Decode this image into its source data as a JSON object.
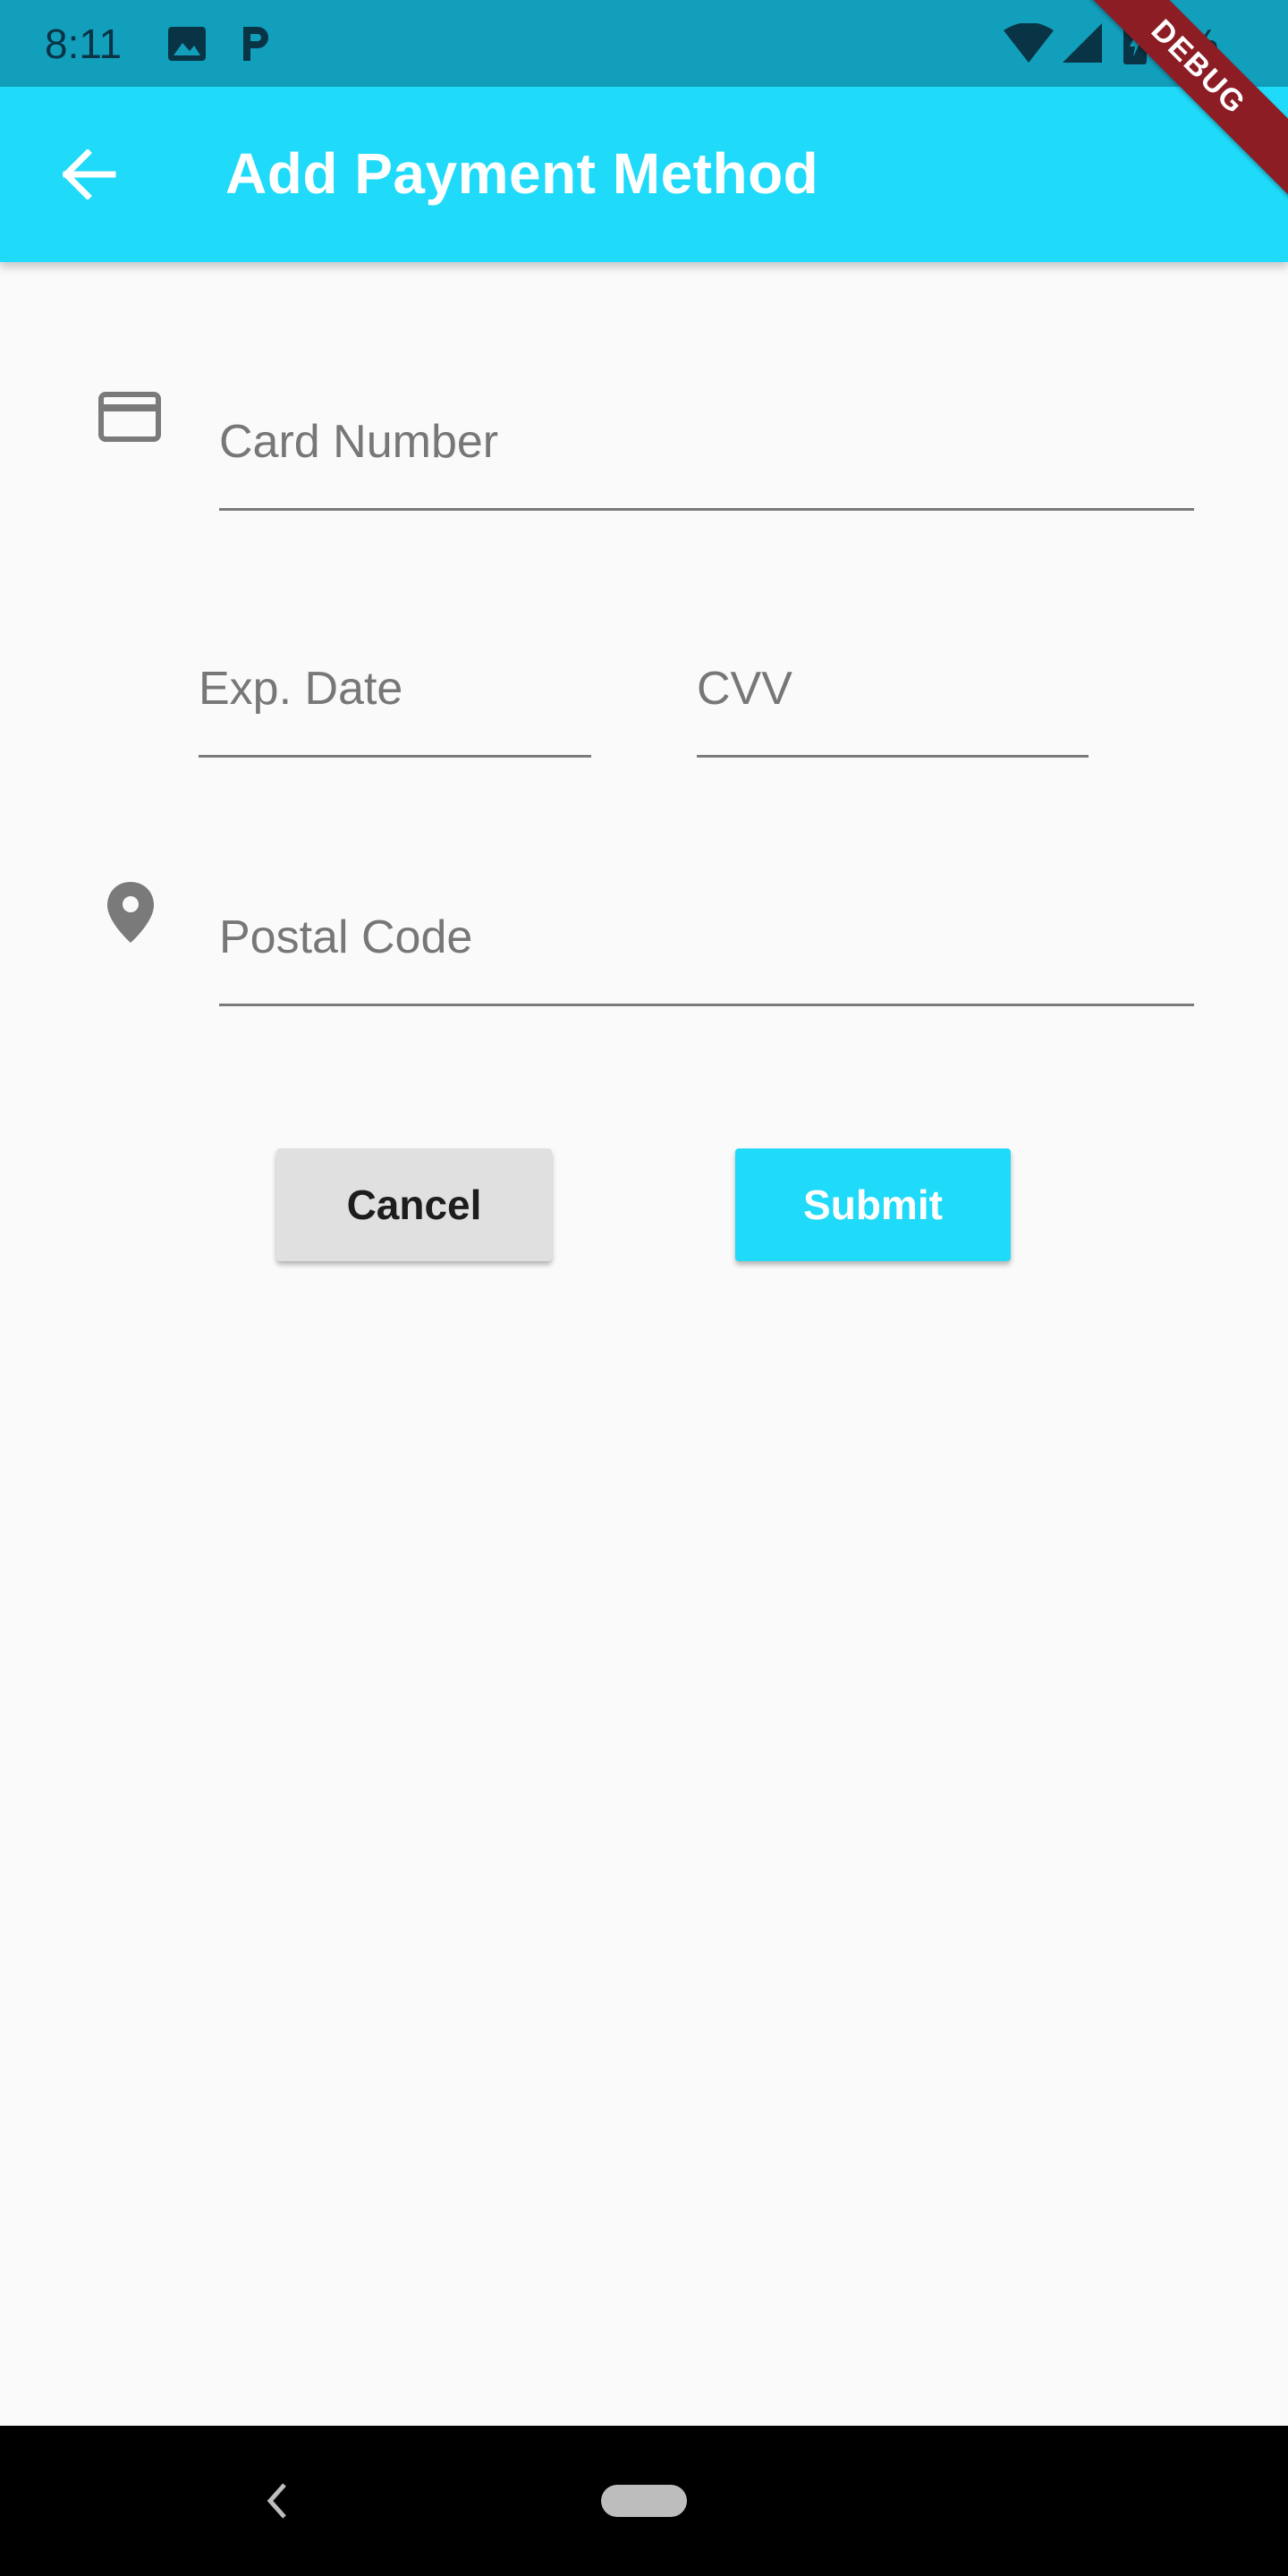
{
  "status_bar": {
    "time": "8:11",
    "icons": [
      "image-icon",
      "parking-icon",
      "wifi-icon",
      "signal-icon",
      "battery-icon"
    ],
    "battery_partial": "9%"
  },
  "app_bar": {
    "title": "Add Payment Method",
    "back_icon": "arrow-back-icon",
    "color": "#1fdaf8"
  },
  "debug_banner": "DEBUG",
  "form": {
    "card_number": {
      "placeholder": "Card Number",
      "value": "",
      "icon": "credit-card-icon"
    },
    "exp_date": {
      "placeholder": "Exp. Date",
      "value": ""
    },
    "cvv": {
      "placeholder": "CVV",
      "value": ""
    },
    "postal_code": {
      "placeholder": "Postal Code",
      "value": "",
      "icon": "location-pin-icon"
    }
  },
  "buttons": {
    "cancel": "Cancel",
    "submit": "Submit"
  },
  "nav_bar": {
    "back_icon": "chevron-left-icon",
    "home_icon": "home-pill-icon"
  }
}
